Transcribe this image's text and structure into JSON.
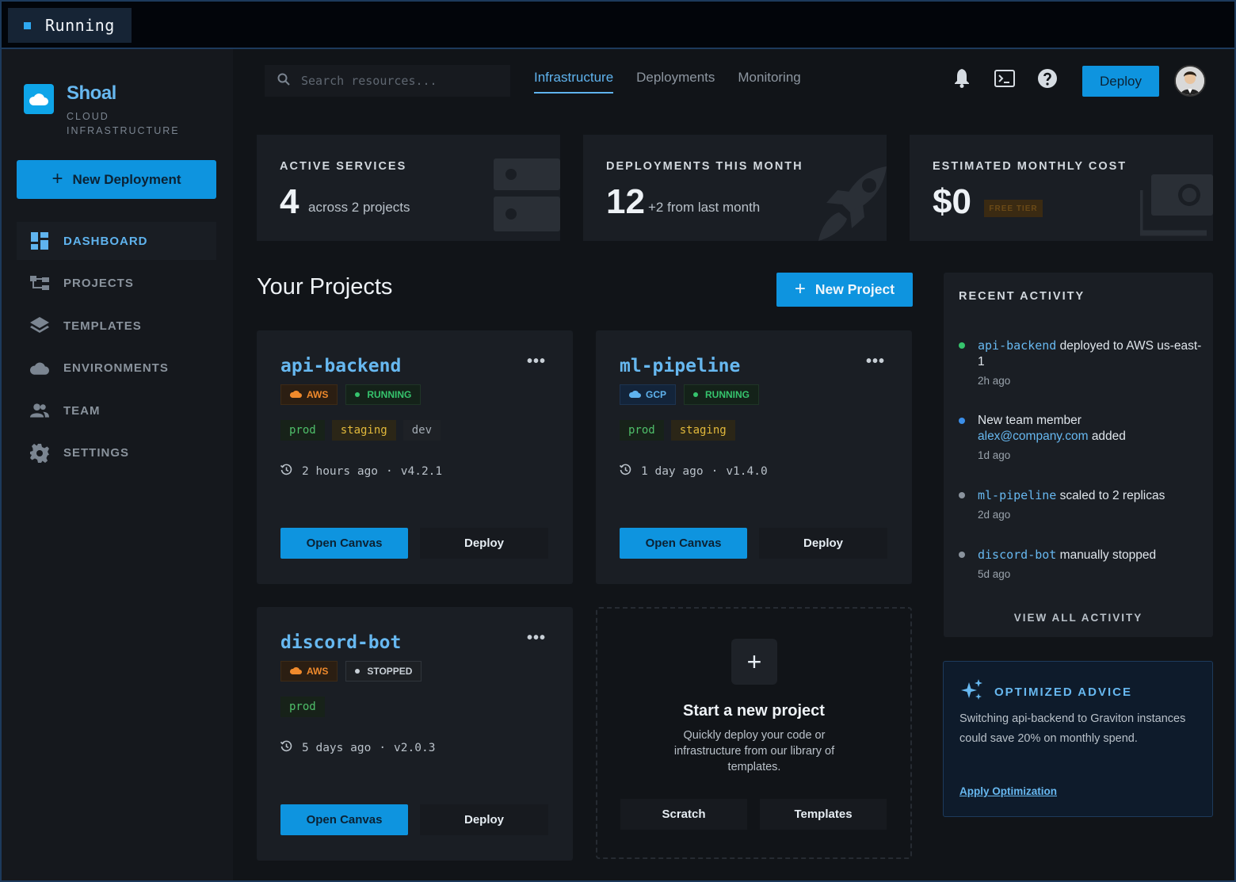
{
  "status": {
    "label": "Running"
  },
  "brand": {
    "name": "Shoal",
    "subtitle": "CLOUD INFRASTRUCTURE"
  },
  "sidebar": {
    "new_deployment": "New Deployment",
    "items": [
      {
        "label": "DASHBOARD",
        "icon": "dashboard-icon",
        "active": true
      },
      {
        "label": "PROJECTS",
        "icon": "projects-icon"
      },
      {
        "label": "TEMPLATES",
        "icon": "layers-icon"
      },
      {
        "label": "ENVIRONMENTS",
        "icon": "cloud-icon"
      },
      {
        "label": "TEAM",
        "icon": "team-icon"
      },
      {
        "label": "SETTINGS",
        "icon": "gear-icon"
      }
    ]
  },
  "header": {
    "search_placeholder": "Search resources...",
    "tabs": [
      {
        "label": "Infrastructure",
        "active": true
      },
      {
        "label": "Deployments"
      },
      {
        "label": "Monitoring"
      }
    ],
    "deploy_label": "Deploy"
  },
  "stats": [
    {
      "label": "ACTIVE SERVICES",
      "value": "4",
      "sub": "across 2 projects"
    },
    {
      "label": "DEPLOYMENTS THIS MONTH",
      "value": "12",
      "sub": "+2 from last month"
    },
    {
      "label": "ESTIMATED MONTHLY COST",
      "value": "$0",
      "badge": "FREE TIER"
    }
  ],
  "projects_section": {
    "title": "Your Projects",
    "new_project": "New Project"
  },
  "projects": [
    {
      "name": "api-backend",
      "cloud": "AWS",
      "status": "RUNNING",
      "envs": [
        "prod",
        "staging",
        "dev"
      ],
      "updated": "2 hours ago",
      "version": "v4.2.1",
      "open_label": "Open Canvas",
      "deploy_label": "Deploy"
    },
    {
      "name": "ml-pipeline",
      "cloud": "GCP",
      "status": "RUNNING",
      "envs": [
        "prod",
        "staging"
      ],
      "updated": "1 day ago",
      "version": "v1.4.0",
      "open_label": "Open Canvas",
      "deploy_label": "Deploy"
    },
    {
      "name": "discord-bot",
      "cloud": "AWS",
      "status": "STOPPED",
      "envs": [
        "prod"
      ],
      "updated": "5 days ago",
      "version": "v2.0.3",
      "open_label": "Open Canvas",
      "deploy_label": "Deploy"
    }
  ],
  "new_project_card": {
    "title": "Start a new project",
    "description": "Quickly deploy your code or infrastructure from our library of templates.",
    "scratch": "Scratch",
    "templates": "Templates"
  },
  "activity": {
    "title": "RECENT ACTIVITY",
    "items": [
      {
        "subject": "api-backend",
        "text": "deployed to AWS us-east-1",
        "time": "2h ago",
        "dot": "#36c46d"
      },
      {
        "prefix": "New team member",
        "link": "alex@company.com",
        "suffix": "added",
        "time": "1d ago",
        "dot": "#3b8ee8"
      },
      {
        "subject": "ml-pipeline",
        "text": "scaled to 2 replicas",
        "time": "2d ago",
        "dot": "#8a939d"
      },
      {
        "subject": "discord-bot",
        "text": "manually stopped",
        "time": "5d ago",
        "dot": "#8a939d"
      }
    ],
    "view_all": "VIEW ALL ACTIVITY"
  },
  "advice": {
    "title": "OPTIMIZED ADVICE",
    "body": "Switching api-backend to Graviton instances could save 20% on monthly spend.",
    "apply": "Apply Optimization"
  },
  "colors": {
    "accent": "#0e94df",
    "link": "#67b8f0",
    "running": "#36c46d",
    "aws": "#f08a2c"
  }
}
